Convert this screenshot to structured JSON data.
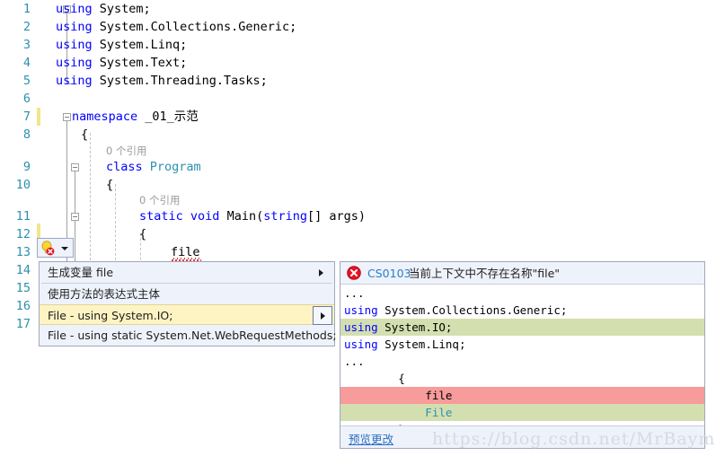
{
  "editor": {
    "line_numbers": [
      "1",
      "2",
      "3",
      "4",
      "5",
      "6",
      "7",
      "8",
      "9",
      "10",
      "11",
      "12",
      "13",
      "14",
      "15",
      "16",
      "17"
    ],
    "lines": [
      {
        "n": "1",
        "text": "using System;"
      },
      {
        "n": "2",
        "text": "using System.Collections.Generic;"
      },
      {
        "n": "3",
        "text": "using System.Linq;"
      },
      {
        "n": "4",
        "text": "using System.Text;"
      },
      {
        "n": "5",
        "text": "using System.Threading.Tasks;"
      },
      {
        "n": "6",
        "text": ""
      },
      {
        "n": "7",
        "text": "namespace _01_示范"
      },
      {
        "n": "8",
        "text": "{"
      },
      {
        "n": "9",
        "text": "    class Program"
      },
      {
        "n": "10",
        "text": "    {"
      },
      {
        "n": "11",
        "text": "        static void Main(string[] args)"
      },
      {
        "n": "12",
        "text": "        {"
      },
      {
        "n": "13",
        "text": "            file"
      }
    ],
    "tokens": {
      "using": "using",
      "ns_System": "System;",
      "ns_Collections": "System.Collections.Generic;",
      "ns_Linq": "System.Linq;",
      "ns_Text": "System.Text;",
      "ns_Tasks": "System.Threading.Tasks;",
      "namespace_kw": "namespace",
      "namespace_name": "_01_示范",
      "brace_open": "{",
      "class_kw": "class",
      "class_name": "Program",
      "static_kw": "static",
      "void_kw": "void",
      "main_name": "Main(",
      "string_kw": "string",
      "args_rest": "[] args)",
      "file_ident": "file"
    },
    "codelens": {
      "class_refs": "0 个引用",
      "method_refs": "0 个引用"
    }
  },
  "lightbulb": {
    "icon": "lightbulb-error-icon",
    "dropdown_icon": "chevron-down-icon"
  },
  "context_menu": {
    "items": [
      {
        "label": "生成变量 file",
        "has_submenu": true,
        "selected": false,
        "separator_after": true
      },
      {
        "label": "使用方法的表达式主体",
        "has_submenu": false,
        "selected": false,
        "separator_after": false
      },
      {
        "label": "File - using System.IO;",
        "has_submenu": true,
        "selected": true,
        "separator_after": false
      },
      {
        "label": "File - using static System.Net.WebRequestMethods;",
        "has_submenu": false,
        "selected": false,
        "separator_after": false
      }
    ]
  },
  "preview": {
    "header": {
      "icon": "error-circle-icon",
      "code": "CS0103",
      "message": "当前上下文中不存在名称\"file\""
    },
    "diff_lines": [
      {
        "text": "...",
        "kind": "context",
        "kw": ""
      },
      {
        "text": "using System.Collections.Generic;",
        "kind": "context",
        "kw": "using"
      },
      {
        "text": "using System.IO;",
        "kind": "add",
        "kw": "using"
      },
      {
        "text": "using System.Linq;",
        "kind": "context",
        "kw": "using"
      },
      {
        "text": "...",
        "kind": "context",
        "kw": ""
      },
      {
        "text": "        {",
        "kind": "context",
        "kw": ""
      },
      {
        "text": "            file",
        "kind": "del",
        "kw": ""
      },
      {
        "text": "            File",
        "kind": "add",
        "kw": "",
        "type_token": true
      },
      {
        "text": "        }",
        "kind": "context",
        "kw": ""
      },
      {
        "text": "...",
        "kind": "context",
        "kw": ""
      }
    ],
    "footer": {
      "preview_changes_label": "预览更改"
    }
  },
  "watermark": {
    "text": "https://blog.csdn.net/MrBaymax"
  },
  "colors": {
    "keyword_blue": "#0000ff",
    "type_teal": "#2b91af",
    "linenum_teal": "#2b91af",
    "codelens_gray": "#9a9a9a",
    "menu_bg": "#eef2fb",
    "menu_selected": "#fdf3c3",
    "diff_add": "#d4dfb0",
    "diff_del": "#f79b9b",
    "error_red": "#e81123",
    "link_blue": "#2b6fc4",
    "changebar_yellow": "#f0e68c"
  }
}
